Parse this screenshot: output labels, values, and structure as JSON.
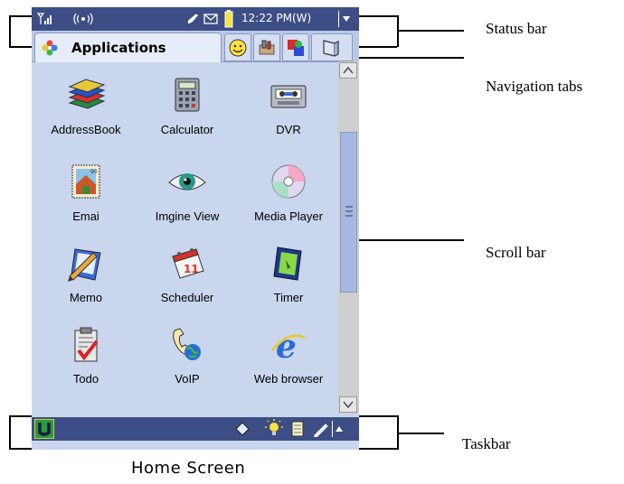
{
  "status_bar": {
    "signal_icon": "signal-bars-icon",
    "connection_icon": "wireless-icon",
    "call_icon": "phone-icon",
    "message_icon": "envelope-icon",
    "battery_icon": "battery-icon",
    "time": "12:22 PM(W)",
    "menu_icon": "dropdown-arrow-icon"
  },
  "tabs": {
    "active_label": "Applications",
    "active_icon": "flower-icon",
    "others": [
      "smiley-icon",
      "tools-icon",
      "shapes-icon",
      "window-icon"
    ]
  },
  "apps": [
    {
      "label": "AddressBook",
      "icon": "books-icon"
    },
    {
      "label": "Calculator",
      "icon": "calculator-icon"
    },
    {
      "label": "DVR",
      "icon": "cassette-icon"
    },
    {
      "label": "Emai",
      "icon": "stamp-icon"
    },
    {
      "label": "Imgine View",
      "icon": "eye-icon"
    },
    {
      "label": "Media Player",
      "icon": "cd-icon"
    },
    {
      "label": "Memo",
      "icon": "notepad-pencil-icon"
    },
    {
      "label": "Scheduler",
      "icon": "calendar-icon"
    },
    {
      "label": "Timer",
      "icon": "clock-icon"
    },
    {
      "label": "Todo",
      "icon": "clipboard-check-icon"
    },
    {
      "label": "VoIP",
      "icon": "phone-globe-icon"
    },
    {
      "label": "Web browser",
      "icon": "browser-e-icon"
    }
  ],
  "taskbar": {
    "start_icon": "u-logo-icon",
    "tray_icons": [
      "diamond-icon",
      "lightbulb-icon",
      "notepad-icon",
      "pen-icon",
      "up-arrow-icon"
    ]
  },
  "callouts": {
    "status_bar": "Status bar",
    "navigation_tabs": "Navigation tabs",
    "scroll_bar": "Scroll bar",
    "taskbar": "Taskbar"
  },
  "caption": "Home Screen",
  "colors": {
    "bar": "#3d4e86",
    "screen_bg": "#c9d6ee",
    "scroll_thumb": "#a4b8e2"
  }
}
